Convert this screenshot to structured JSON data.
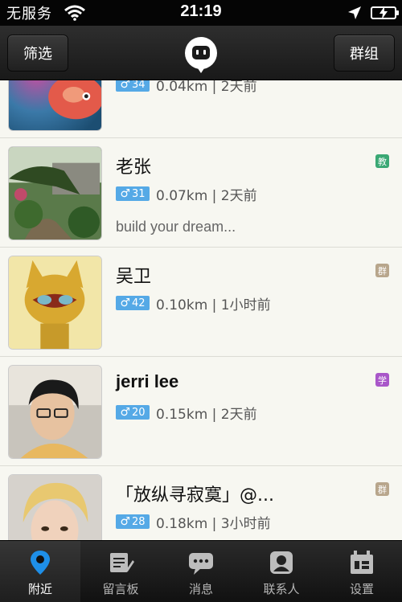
{
  "status_bar": {
    "carrier": "无服务",
    "time": "21:19"
  },
  "nav": {
    "left_button": "筛选",
    "right_button": "群组",
    "logo_icon": "chat-bubble-logo-icon"
  },
  "users": [
    {
      "name": "",
      "age": "34",
      "distance": "0.04km | 2天前",
      "signature": "",
      "badge": ""
    },
    {
      "name": "老张",
      "age": "31",
      "distance": "0.07km | 2天前",
      "signature": "build your dream...",
      "badge": "教",
      "badge_color": "#3aa874"
    },
    {
      "name": "吴卫",
      "age": "42",
      "distance": "0.10km | 1小时前",
      "signature": "",
      "badge": "群",
      "badge_color": "#b8a68c"
    },
    {
      "name": "jerri lee",
      "age": "20",
      "distance": "0.15km | 2天前",
      "signature": "",
      "badge": "学",
      "badge_color": "#a957c9"
    },
    {
      "name": "「放纵寻寂寞」@...",
      "age": "28",
      "distance": "0.18km | 3小时前",
      "signature": "",
      "badge": "群",
      "badge_color": "#b8a68c"
    }
  ],
  "gender_symbol": "♂",
  "tabs": [
    {
      "label": "附近",
      "icon": "location-pin-icon",
      "active": true
    },
    {
      "label": "留言板",
      "icon": "message-board-icon",
      "active": false
    },
    {
      "label": "消息",
      "icon": "chat-bubble-icon",
      "active": false
    },
    {
      "label": "联系人",
      "icon": "contact-icon",
      "active": false
    },
    {
      "label": "设置",
      "icon": "settings-icon",
      "active": false
    }
  ],
  "colors": {
    "accent": "#1e8fe8",
    "gender_badge": "#55a9e6"
  }
}
